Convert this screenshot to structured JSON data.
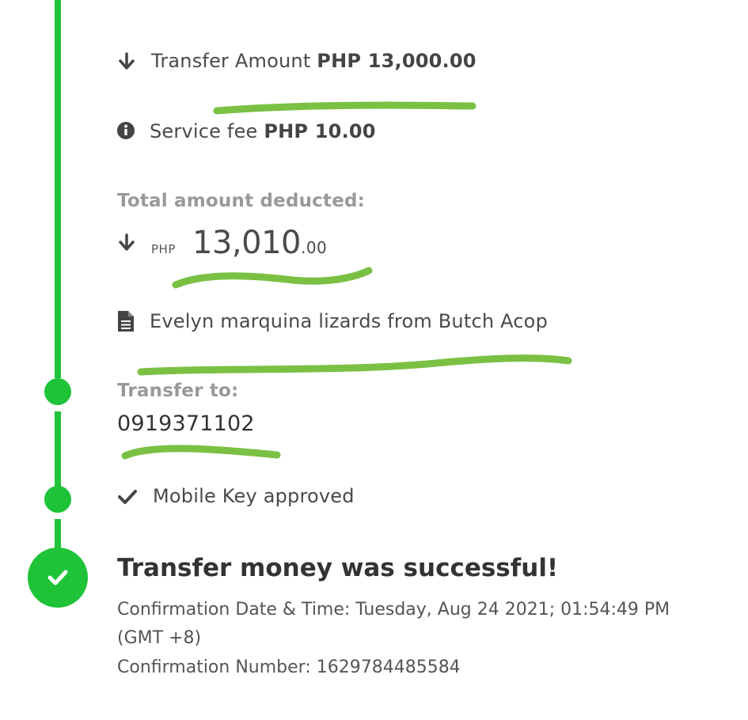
{
  "details": {
    "transfer_amount_label": "Transfer Amount",
    "transfer_amount_value": "PHP  13,000.00",
    "service_fee_label": "Service fee",
    "service_fee_value": "PHP  10.00",
    "total_label": "Total amount deducted:",
    "total_currency": "PHP",
    "total_whole": "13,010",
    "total_cents": ".00",
    "note": "Evelyn marquina lizards from Butch Acop"
  },
  "recipient": {
    "label": "Transfer to:",
    "number": "0919371102"
  },
  "mobile_key": {
    "label": "Mobile Key approved"
  },
  "result": {
    "title": "Transfer money was successful!",
    "confirmation_datetime_line1": "Confirmation Date & Time: Tuesday, Aug 24 2021; 01:54:49 PM",
    "confirmation_datetime_line2": "(GMT +8)",
    "confirmation_number": "Confirmation Number: 1629784485584"
  },
  "colors": {
    "timeline": "#1ec337",
    "highlight_marker": "#7ac143"
  },
  "icons": [
    "arrow-down-icon",
    "info-icon",
    "document-icon",
    "checkmark-icon"
  ]
}
